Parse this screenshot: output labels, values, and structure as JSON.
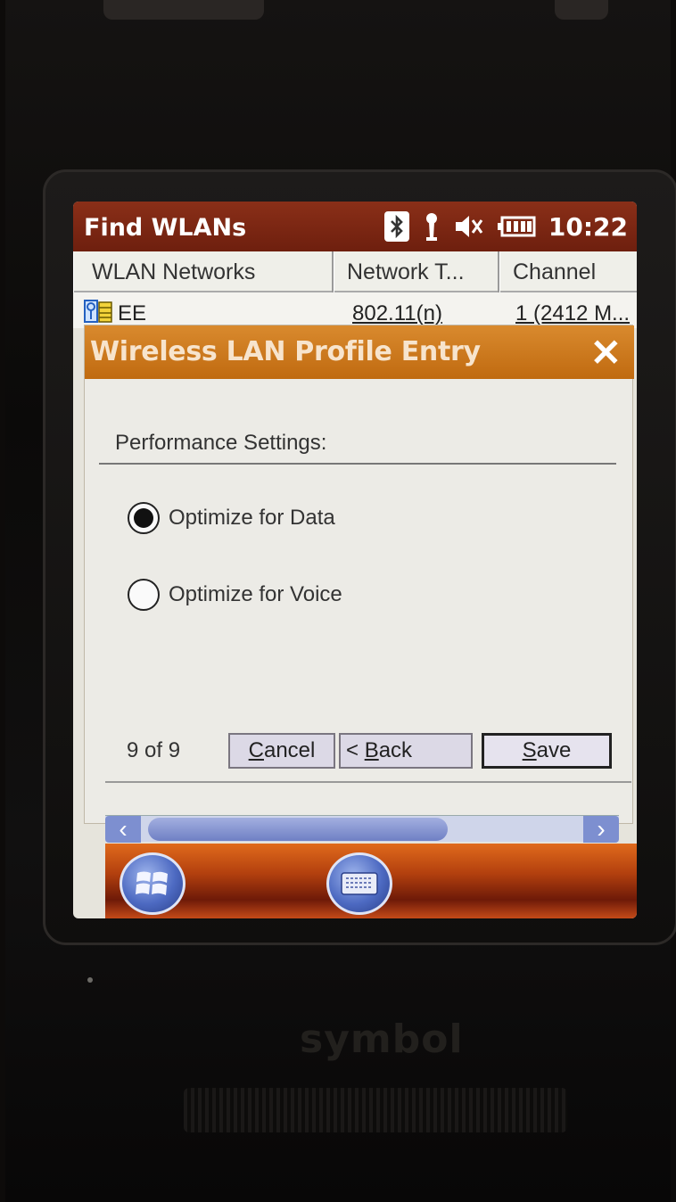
{
  "titlebar": {
    "title": "Find WLANs",
    "time": "10:22",
    "status_icons": [
      "bluetooth-icon",
      "antenna-icon",
      "volume-muted-icon",
      "battery-icon"
    ]
  },
  "list": {
    "columns": [
      "WLAN Networks",
      "Network T...",
      "Channel"
    ],
    "rows": [
      {
        "ssid": "EE",
        "type": "802.11(n)",
        "channel": "1 (2412 M..."
      }
    ]
  },
  "dialog": {
    "title": "Wireless LAN Profile Entry",
    "section_label": "Performance Settings:",
    "options": [
      {
        "label": "Optimize for Data",
        "selected": true
      },
      {
        "label": "Optimize for Voice",
        "selected": false
      }
    ],
    "step": "9 of 9",
    "buttons": {
      "cancel_underlined": "C",
      "cancel_rest": "ancel",
      "back_prefix": "< ",
      "back_underlined": "B",
      "back_rest": "ack",
      "save_underlined": "S",
      "save_rest": "ave"
    }
  },
  "colors": {
    "titlebar": "#7a2612",
    "dialog_title": "#cf7a20",
    "taskbar": "#b3400e",
    "scroll_accent": "#7d8fd0"
  },
  "brand": "symbol"
}
